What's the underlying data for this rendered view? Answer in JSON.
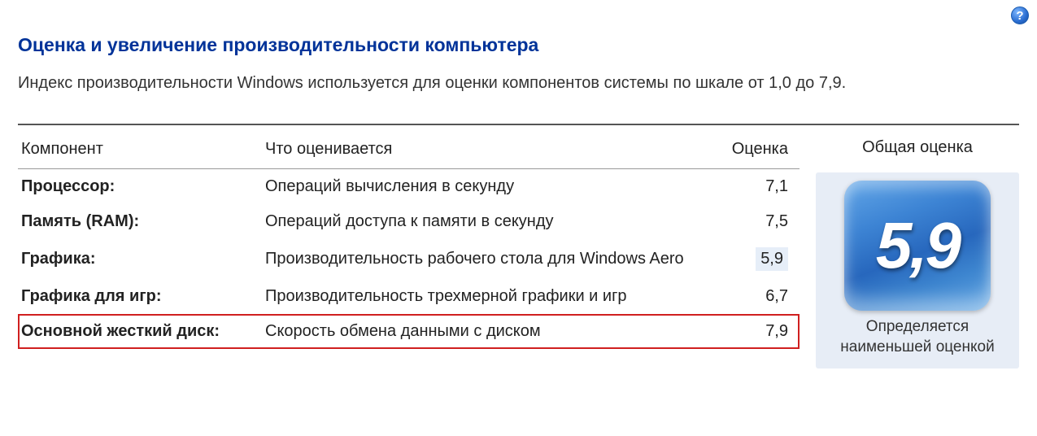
{
  "help_icon_label": "?",
  "page_title": "Оценка и увеличение производительности компьютера",
  "page_subtitle": "Индекс производительности Windows используется для оценки компонентов системы по шкале от 1,0 до 7,9.",
  "columns": {
    "component": "Компонент",
    "description": "Что оценивается",
    "score": "Оценка",
    "overall": "Общая оценка"
  },
  "rows": [
    {
      "component": "Процессор:",
      "description": "Операций вычисления в секунду",
      "score": "7,1",
      "lowest": false,
      "highlight": false
    },
    {
      "component": "Память (RAM):",
      "description": "Операций доступа к памяти в секунду",
      "score": "7,5",
      "lowest": false,
      "highlight": false
    },
    {
      "component": "Графика:",
      "description": "Производительность рабочего стола для Windows Aero",
      "score": "5,9",
      "lowest": true,
      "highlight": false
    },
    {
      "component": "Графика для игр:",
      "description": "Производительность трехмерной графики и игр",
      "score": "6,7",
      "lowest": false,
      "highlight": false
    },
    {
      "component": "Основной жесткий диск:",
      "description": "Скорость обмена данными с диском",
      "score": "7,9",
      "lowest": false,
      "highlight": true
    }
  ],
  "overall": {
    "score": "5,9",
    "caption": "Определяется наименьшей оценкой"
  }
}
